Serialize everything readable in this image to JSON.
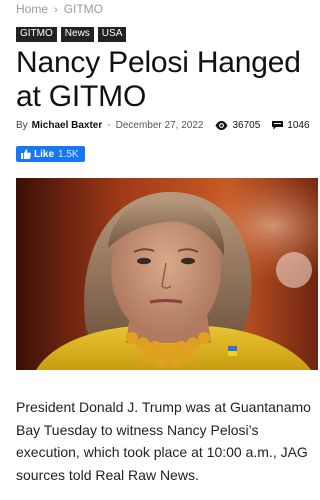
{
  "breadcrumb": {
    "home": "Home",
    "separator": "›",
    "current": "GITMO"
  },
  "tags": [
    "GITMO",
    "News",
    "USA"
  ],
  "article": {
    "title": "Nancy Pelosi Hanged at GITMO",
    "by_label": "By",
    "author": "Michael Baxter",
    "dash": "-",
    "date": "December 27, 2022",
    "views": "36705",
    "comments": "1046",
    "body": "President Donald J. Trump was at Guantanamo Bay Tuesday to witness Nancy Pelosi’s execution, which took place at 10:00 a.m., JAG sources told Real Raw News."
  },
  "facebook": {
    "like_label": "Like",
    "count": "1.5K",
    "color": "#1877f2"
  },
  "icons": {
    "views": "eye-icon",
    "comments": "comment-icon",
    "facebook": "thumbs-up-icon"
  }
}
